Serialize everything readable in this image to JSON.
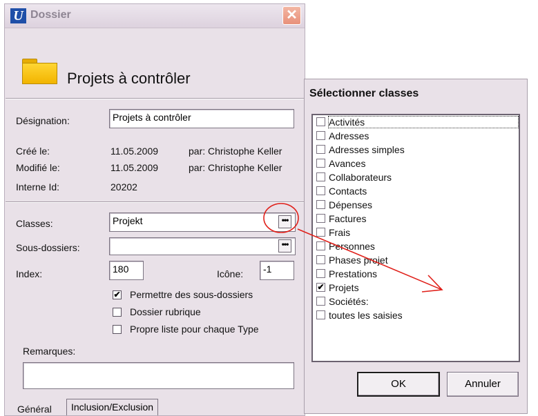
{
  "dossier_window": {
    "app_icon_letter": "U",
    "title": "Dossier",
    "close_glyph": "✕",
    "header_title": "Projets à contrôler",
    "designation": {
      "label": "Désignation:",
      "value": "Projets à contrôler"
    },
    "created": {
      "label": "Créé le:",
      "date": "11.05.2009",
      "by": "par: Christophe Keller"
    },
    "modified": {
      "label": "Modifié le:",
      "date": "11.05.2009",
      "by": "par: Christophe Keller"
    },
    "internal_id": {
      "label": "Interne Id:",
      "value": "20202"
    },
    "classes": {
      "label": "Classes:",
      "value": "Projekt",
      "button": "•••"
    },
    "subfolders": {
      "label": "Sous-dossiers:",
      "value": "",
      "button": "•••"
    },
    "index": {
      "label": "Index:",
      "value": "180"
    },
    "icon": {
      "label": "Icône:",
      "value": "-1"
    },
    "checkboxes": [
      {
        "label": "Permettre des sous-dossiers",
        "checked": true
      },
      {
        "label": "Dossier rubrique",
        "checked": false
      },
      {
        "label": "Propre liste pour chaque Type",
        "checked": false
      }
    ],
    "remarks": {
      "label": "Remarques:",
      "value": ""
    },
    "tabs": [
      {
        "label": "Général",
        "active": true
      },
      {
        "label": "Inclusion/Exclusion",
        "active": false
      }
    ]
  },
  "select_dialog": {
    "title": "Sélectionner classes",
    "items": [
      {
        "label": "Activités",
        "checked": false,
        "focused": true
      },
      {
        "label": "Adresses",
        "checked": false
      },
      {
        "label": "Adresses simples",
        "checked": false
      },
      {
        "label": "Avances",
        "checked": false
      },
      {
        "label": "Collaborateurs",
        "checked": false
      },
      {
        "label": "Contacts",
        "checked": false
      },
      {
        "label": "Dépenses",
        "checked": false
      },
      {
        "label": "Factures",
        "checked": false
      },
      {
        "label": "Frais",
        "checked": false
      },
      {
        "label": "Personnes",
        "checked": false
      },
      {
        "label": "Phases projet",
        "checked": false
      },
      {
        "label": "Prestations",
        "checked": false
      },
      {
        "label": "Projets",
        "checked": true
      },
      {
        "label": "Sociétés:",
        "checked": false
      },
      {
        "label": "toutes les saisies",
        "checked": false
      }
    ],
    "ok_label": "OK",
    "cancel_label": "Annuler",
    "check_glyph": "✔"
  },
  "colors": {
    "annotation": "#e0201a",
    "window_bg": "#e9e1e8"
  }
}
